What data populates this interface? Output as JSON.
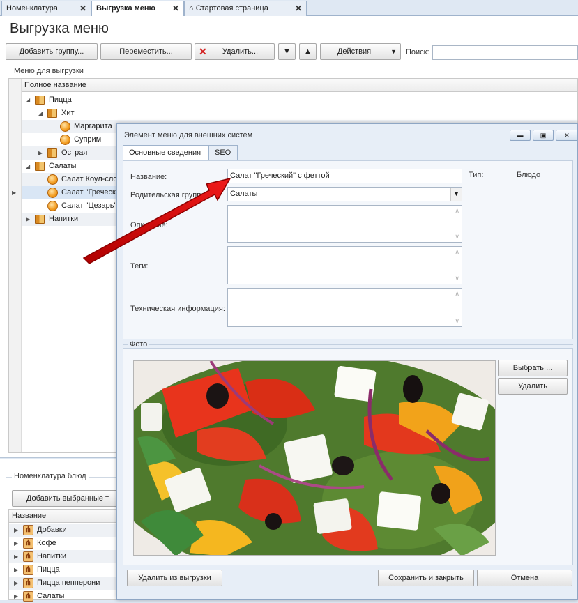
{
  "tabs": [
    {
      "label": "Номенклатура"
    },
    {
      "label": "Выгрузка меню"
    },
    {
      "label": "Стартовая страница"
    }
  ],
  "page_title": "Выгрузка меню",
  "toolbar": {
    "add_group": "Добавить группу...",
    "move": "Переместить...",
    "delete": "Удалить...",
    "actions": "Действия",
    "search_label": "Поиск:",
    "search_value": ""
  },
  "menu_group": {
    "label": "Меню для выгрузки",
    "column": "Полное название",
    "rows": [
      {
        "label": "Пицца"
      },
      {
        "label": "Хит"
      },
      {
        "label": "Маргарита"
      },
      {
        "label": "Суприм"
      },
      {
        "label": "Острая"
      },
      {
        "label": "Салаты"
      },
      {
        "label": "Салат Коул-слоу"
      },
      {
        "label": "Салат \"Греческ"
      },
      {
        "label": "Салат \"Цезарь\""
      },
      {
        "label": "Напитки"
      }
    ]
  },
  "nomenclature": {
    "label": "Номенклатура блюд",
    "add_button": "Добавить выбранные т",
    "column": "Название",
    "rows": [
      {
        "label": "Добавки"
      },
      {
        "label": "Кофе"
      },
      {
        "label": "Напитки"
      },
      {
        "label": "Пицца"
      },
      {
        "label": "Пицца пепперони"
      },
      {
        "label": "Салаты"
      }
    ]
  },
  "dialog": {
    "title": "Элемент меню для внешних систем",
    "tabs": [
      "Основные сведения",
      "SEO"
    ],
    "name_label": "Название:",
    "name_value": "Салат \"Греческий\" с феттой",
    "type_label": "Тип:",
    "type_value": "Блюдо",
    "parent_label": "Родительская группа:",
    "parent_value": "Салаты",
    "description_label": "Описание:",
    "tags_label": "Теги:",
    "tech_label": "Техническая информация:",
    "photo_label": "Фото",
    "choose_button": "Выбрать ...",
    "delete_photo_button": "Удалить",
    "remove_button": "Удалить из выгрузки",
    "save_close_button": "Сохранить и закрыть",
    "cancel_button": "Отмена"
  }
}
